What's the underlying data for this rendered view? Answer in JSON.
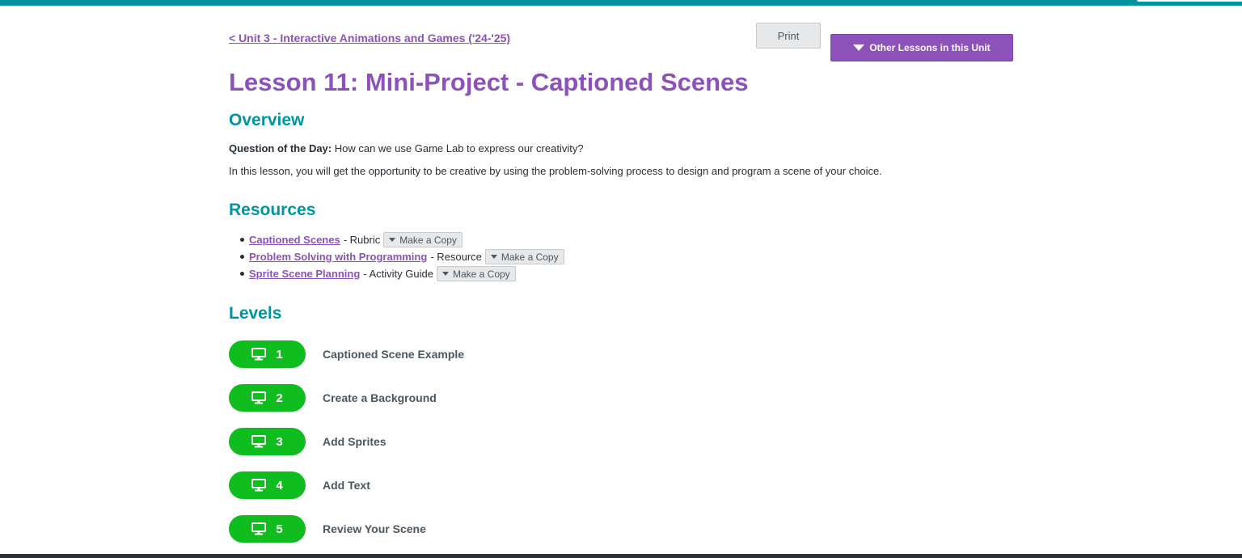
{
  "header": {
    "unit_link": "< Unit 3 - Interactive Animations and Games ('24-'25)",
    "print_label": "Print",
    "other_lessons_label": "Other Lessons in this Unit"
  },
  "lesson": {
    "title": "Lesson 11: Mini-Project - Captioned Scenes"
  },
  "overview": {
    "heading": "Overview",
    "question_label": "Question of the Day:",
    "question_text": " How can we use Game Lab to express our creativity?",
    "description": "In this lesson, you will get the opportunity to be creative by using the problem-solving process to design and program a scene of your choice."
  },
  "resources": {
    "heading": "Resources",
    "copy_label": "Make a Copy",
    "items": [
      {
        "name": "Captioned Scenes",
        "type": "- Rubric"
      },
      {
        "name": "Problem Solving with Programming",
        "type": "- Resource"
      },
      {
        "name": "Sprite Scene Planning",
        "type": "- Activity Guide"
      }
    ]
  },
  "levels": {
    "heading": "Levels",
    "items": [
      {
        "number": "1",
        "name": "Captioned Scene Example"
      },
      {
        "number": "2",
        "name": "Create a Background"
      },
      {
        "number": "3",
        "name": "Add Sprites"
      },
      {
        "number": "4",
        "name": "Add Text"
      },
      {
        "number": "5",
        "name": "Review Your Scene"
      }
    ]
  },
  "colors": {
    "brand_teal": "#0094a3",
    "brand_purple": "#8c52ba",
    "level_green": "#0fbe1e"
  },
  "icons": {
    "level_icon": "monitor-icon",
    "dropdown_icon": "caret-down-icon"
  }
}
